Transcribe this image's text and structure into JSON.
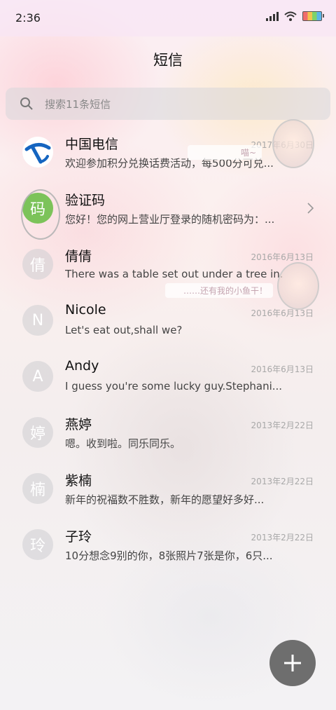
{
  "status": {
    "time": "2:36"
  },
  "header": {
    "title": "短信"
  },
  "search": {
    "placeholder": "搜索11条短信"
  },
  "conversations": [
    {
      "name": "中国电信",
      "preview": "欢迎参加积分兑换话费活动，每500分可兑...",
      "date": "2017年6月30日",
      "avatar_letter": "",
      "avatar_type": "carrier-logo"
    },
    {
      "name": "验证码",
      "preview": "您好！您的网上营业厅登录的随机密码为：...",
      "date": "",
      "avatar_letter": "码",
      "avatar_type": "green"
    },
    {
      "name": "倩倩",
      "preview": "There was a table set out under a tree in...",
      "date": "2016年6月13日",
      "avatar_letter": "倩",
      "avatar_type": "gray"
    },
    {
      "name": "Nicole",
      "preview": "Let's eat out,shall we?",
      "date": "2016年6月13日",
      "avatar_letter": "N",
      "avatar_type": "gray"
    },
    {
      "name": "Andy",
      "preview": "I guess you're some lucky guy.Stephani...",
      "date": "2016年6月13日",
      "avatar_letter": "A",
      "avatar_type": "gray"
    },
    {
      "name": "燕婷",
      "preview": "嗯。收到啦。同乐同乐。",
      "date": "2013年2月22日",
      "avatar_letter": "婷",
      "avatar_type": "gray"
    },
    {
      "name": "紫楠",
      "preview": "新年的祝福数不胜数，新年的愿望好多好...",
      "date": "2013年2月22日",
      "avatar_letter": "楠",
      "avatar_type": "gray"
    },
    {
      "name": "子玲",
      "preview": "10分想念9别的你，8张照片7张是你，6只...",
      "date": "2013年2月22日",
      "avatar_letter": "玲",
      "avatar_type": "gray"
    }
  ],
  "wallpaper_bubbles": {
    "bubble1": "喵~",
    "bubble2": "……还有我的小鱼干！"
  },
  "colors": {
    "accent_green": "#7cc35a",
    "fab": "#6e6e6e",
    "carrier_blue": "#1565c0"
  },
  "icons": {
    "search": "search-icon",
    "fab": "plus-icon",
    "chevron": "chevron-right-icon"
  }
}
